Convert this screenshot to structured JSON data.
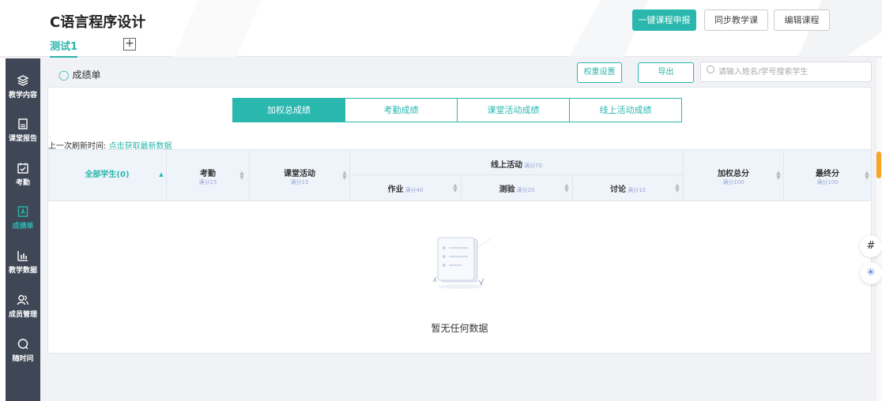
{
  "header": {
    "course_title": "C语言程序设计",
    "active_tab": "测试1",
    "add_tab_symbol": "+",
    "buttons": {
      "report": "一键课程申报",
      "sync": "同步教学课",
      "edit": "编辑课程"
    }
  },
  "sidebar": {
    "items": [
      {
        "label": "教学内容",
        "icon": "layers-icon"
      },
      {
        "label": "课堂报告",
        "icon": "document-icon"
      },
      {
        "label": "考勤",
        "icon": "calendar-check-icon"
      },
      {
        "label": "成绩单",
        "icon": "grade-icon"
      },
      {
        "label": "教学数据",
        "icon": "bar-chart-icon"
      },
      {
        "label": "成员管理",
        "icon": "members-icon"
      },
      {
        "label": "随时问",
        "icon": "chat-icon"
      }
    ],
    "active": "成绩单"
  },
  "main": {
    "section_title": "成绩单",
    "weight_button": "权重设置",
    "export_button": "导出",
    "search_placeholder": "请输入姓名/学号搜索学生",
    "segments": [
      "加权总成绩",
      "考勤成绩",
      "课堂活动成绩",
      "线上活动成绩"
    ],
    "active_segment": "加权总成绩",
    "refresh_label": "上一次刷新时间: ",
    "refresh_link": "点击获取最新数据",
    "columns": {
      "students": "全部学生(0)",
      "attendance": {
        "title": "考勤",
        "sub": "满分15"
      },
      "classroom": {
        "title": "课堂活动",
        "sub": "满分15"
      },
      "online": {
        "title": "线上活动",
        "sub": "满分70"
      },
      "homework": {
        "title": "作业",
        "sub": "满分40"
      },
      "quiz": {
        "title": "测验",
        "sub": "满分20"
      },
      "discussion": {
        "title": "讨论",
        "sub": "满分10"
      },
      "weighted": {
        "title": "加权总分",
        "sub": "满分100"
      },
      "final": {
        "title": "最终分",
        "sub": "满分100"
      }
    },
    "empty_text": "暂无任何数据"
  },
  "colors": {
    "accent": "#2ab7ae",
    "sidebar_bg": "#3f4756",
    "header_bg": "#eef4fa"
  }
}
